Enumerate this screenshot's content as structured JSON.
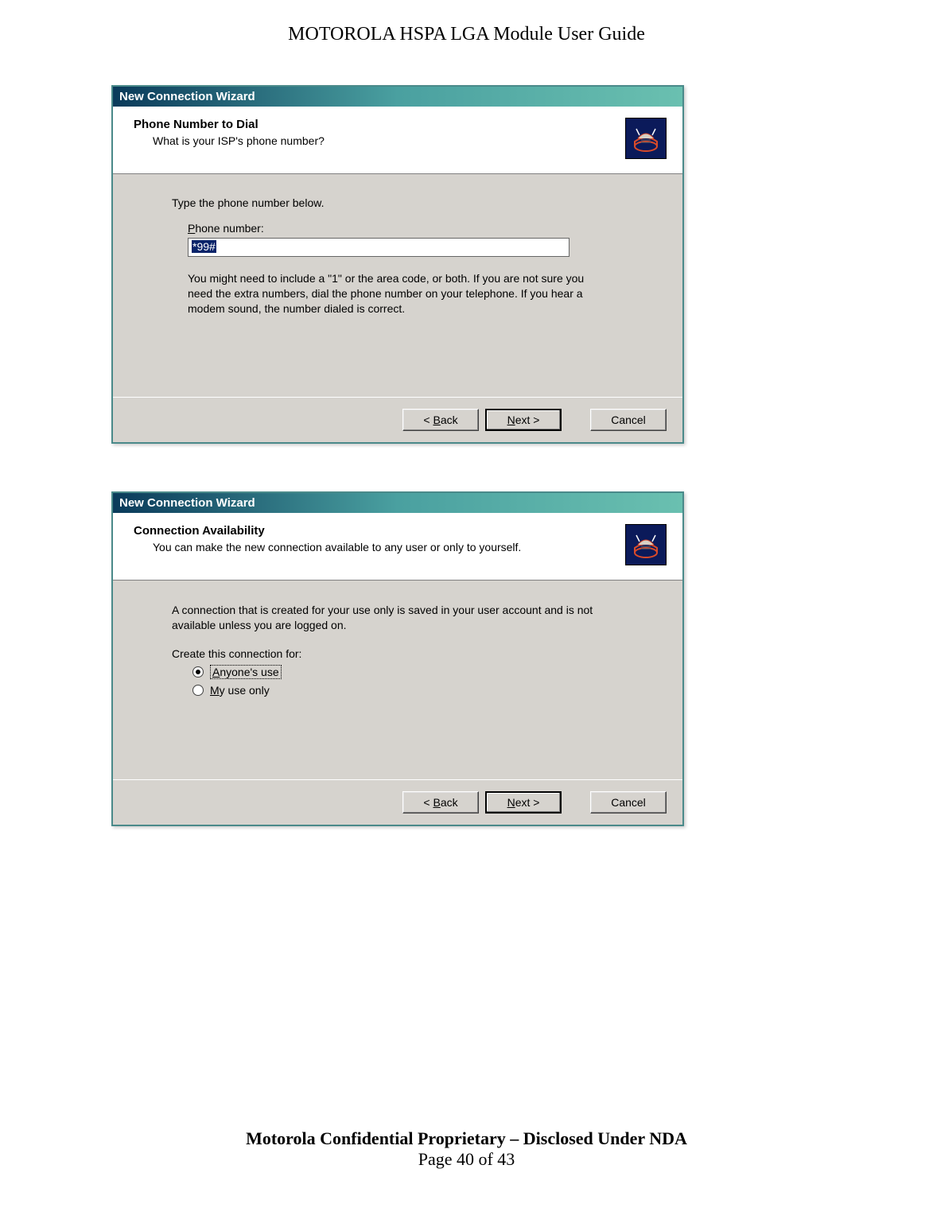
{
  "doc_title": "MOTOROLA HSPA LGA Module User Guide",
  "dialog1": {
    "title": "New Connection Wizard",
    "heading": "Phone Number to Dial",
    "subheading": "What is your ISP's phone number?",
    "instruction": "Type the phone number below.",
    "field_label_pre": "P",
    "field_label_rest": "hone number:",
    "value": "*99#",
    "hint": "You might need to include a \"1\" or the area code, or both. If you are not sure you need the extra numbers, dial the phone number on your telephone. If you hear a modem sound, the number dialed is correct.",
    "back_pre": "< ",
    "back_u": "B",
    "back_rest": "ack",
    "next_u": "N",
    "next_rest": "ext >",
    "cancel": "Cancel"
  },
  "dialog2": {
    "title": "New Connection Wizard",
    "heading": "Connection Availability",
    "subheading": "You can make the new connection available to any user or only to yourself.",
    "intro": "A connection that is created for your use only is saved in your user account and is not available unless you are logged on.",
    "group_label": "Create this connection for:",
    "opt1_u": "A",
    "opt1_rest": "nyone's use",
    "opt2_u": "M",
    "opt2_rest": "y use only",
    "back_pre": "< ",
    "back_u": "B",
    "back_rest": "ack",
    "next_u": "N",
    "next_rest": "ext >",
    "cancel": "Cancel"
  },
  "footer_bold": "Motorola Confidential Proprietary – Disclosed Under NDA",
  "footer_page": "Page 40 of 43"
}
